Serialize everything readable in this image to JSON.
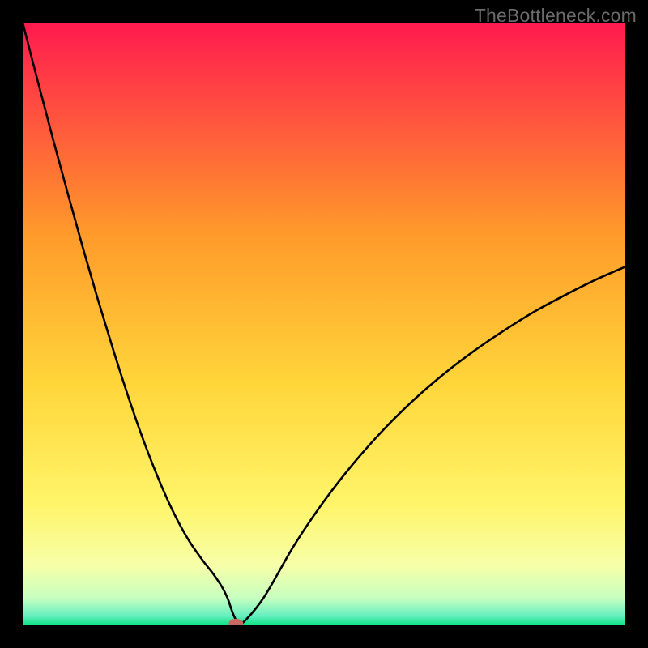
{
  "watermark": "TheBottleneck.com",
  "chart_data": {
    "type": "line",
    "title": "",
    "xlabel": "",
    "ylabel": "",
    "xlim": [
      0,
      100
    ],
    "ylim": [
      0,
      100
    ],
    "grid": false,
    "legend": false,
    "gradient_stops": [
      {
        "offset": 0.0,
        "color": "#ff1a4f"
      },
      {
        "offset": 0.35,
        "color": "#ff9a2a"
      },
      {
        "offset": 0.6,
        "color": "#ffd63a"
      },
      {
        "offset": 0.8,
        "color": "#fff56a"
      },
      {
        "offset": 0.9,
        "color": "#f7ffa8"
      },
      {
        "offset": 0.955,
        "color": "#c7ffc0"
      },
      {
        "offset": 0.985,
        "color": "#63eec0"
      },
      {
        "offset": 1.0,
        "color": "#08e27e"
      }
    ],
    "series": [
      {
        "name": "curve",
        "type": "line",
        "color": "#000000",
        "x": [
          0.0,
          2.5,
          5.0,
          7.5,
          10.0,
          12.5,
          15.0,
          17.5,
          20.0,
          22.5,
          25.0,
          27.5,
          30.0,
          31.5,
          33.0,
          34.0,
          34.8,
          35.6,
          36.3,
          40.0,
          45.0,
          50.0,
          55.0,
          60.0,
          65.0,
          70.0,
          75.0,
          80.0,
          85.0,
          90.0,
          95.0,
          100.0
        ],
        "y": [
          100.0,
          90.3,
          80.8,
          71.6,
          62.6,
          54.0,
          45.8,
          38.0,
          30.8,
          24.4,
          18.8,
          14.2,
          10.6,
          8.7,
          6.5,
          4.5,
          2.2,
          0.5,
          0.2,
          4.6,
          13.2,
          20.6,
          27.0,
          32.6,
          37.5,
          41.8,
          45.6,
          49.0,
          52.1,
          54.8,
          57.3,
          59.5
        ]
      }
    ],
    "marker": {
      "x": 35.4,
      "y": 0.3,
      "rx": 1.2,
      "ry": 0.8,
      "color": "#c96a62"
    }
  }
}
